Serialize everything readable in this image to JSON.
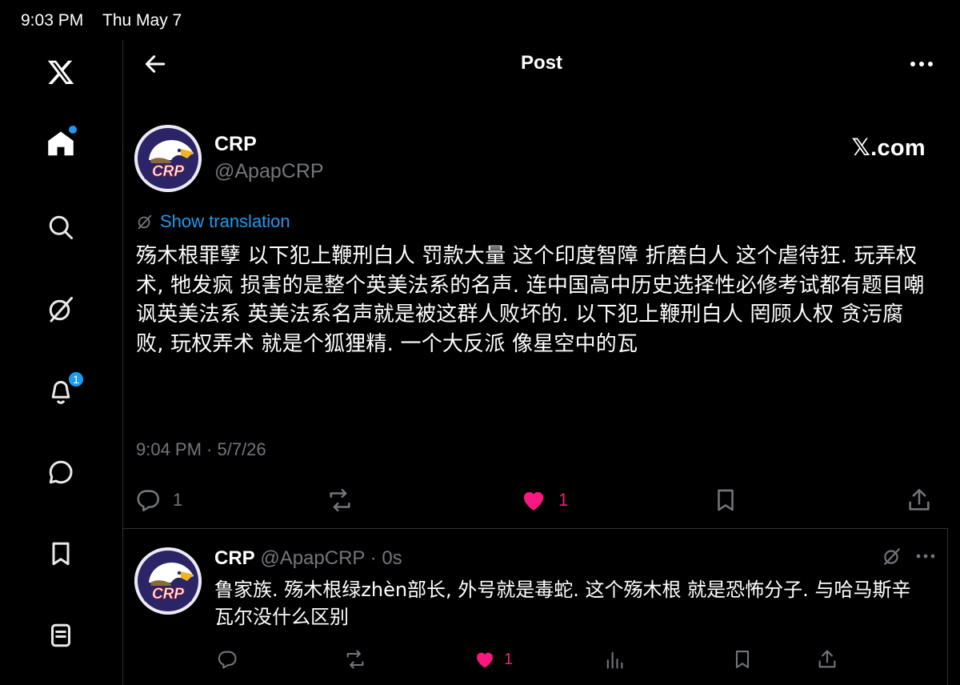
{
  "status_bar": {
    "time": "9:03 PM",
    "date": "Thu May 7"
  },
  "sidebar": {
    "items": [
      {
        "icon": "x-logo-icon"
      },
      {
        "icon": "home-icon",
        "has_dot": true
      },
      {
        "icon": "search-icon"
      },
      {
        "icon": "grok-icon"
      },
      {
        "icon": "bell-icon",
        "badge": "1"
      },
      {
        "icon": "messages-icon"
      },
      {
        "icon": "bookmark-icon"
      },
      {
        "icon": "lists-icon"
      }
    ]
  },
  "header": {
    "title": "Post"
  },
  "post": {
    "author_name": "CRP",
    "author_handle": "@ApapCRP",
    "brand": "𝕏.com",
    "translate_label": "Show translation",
    "text": "殇木根罪孽 以下犯上鞭刑白人 罚款大量 这个印度智障 折磨白人 这个虐待狂. 玩弄权术, 牠发疯 损害的是整个英美法系的名声. 连中国高中历史选择性必修考试都有题目嘲讽英美法系 英美法系名声就是被这群人败坏的. 以下犯上鞭刑白人 罔顾人权 贪污腐败, 玩权弄术 就是个狐狸精. 一个大反派 像星空中的瓦",
    "timestamp": "9:04 PM · 5/7/26",
    "replies": "1",
    "likes": "1",
    "avatar_text": "CRP"
  },
  "reply": {
    "author_name": "CRP",
    "meta": " @ApapCRP · 0s",
    "text": "鲁家族. 殇木根绿zhèn部长, 外号就是毒蛇. 这个殇木根 就是恐怖分子. 与哈马斯辛瓦尔没什么区别",
    "likes": "1",
    "avatar_text": "CRP"
  },
  "colors": {
    "accent": "#1d9bf0",
    "like": "#f91880",
    "muted": "#71767b",
    "background": "#000000"
  }
}
